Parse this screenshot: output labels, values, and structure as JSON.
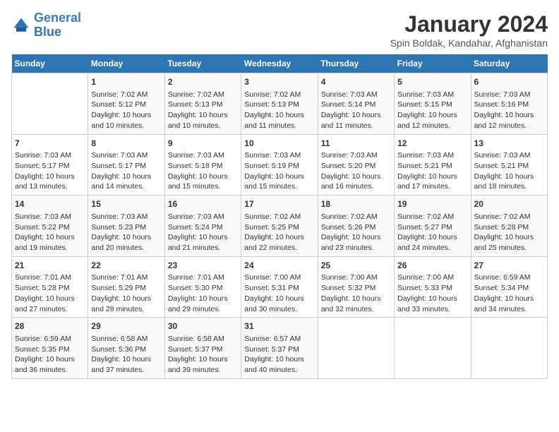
{
  "header": {
    "logo_line1": "General",
    "logo_line2": "Blue",
    "title": "January 2024",
    "subtitle": "Spin Boldak, Kandahar, Afghanistan"
  },
  "columns": [
    "Sunday",
    "Monday",
    "Tuesday",
    "Wednesday",
    "Thursday",
    "Friday",
    "Saturday"
  ],
  "weeks": [
    [
      {
        "num": "",
        "info": ""
      },
      {
        "num": "1",
        "info": "Sunrise: 7:02 AM\nSunset: 5:12 PM\nDaylight: 10 hours\nand 10 minutes."
      },
      {
        "num": "2",
        "info": "Sunrise: 7:02 AM\nSunset: 5:13 PM\nDaylight: 10 hours\nand 10 minutes."
      },
      {
        "num": "3",
        "info": "Sunrise: 7:02 AM\nSunset: 5:13 PM\nDaylight: 10 hours\nand 11 minutes."
      },
      {
        "num": "4",
        "info": "Sunrise: 7:03 AM\nSunset: 5:14 PM\nDaylight: 10 hours\nand 11 minutes."
      },
      {
        "num": "5",
        "info": "Sunrise: 7:03 AM\nSunset: 5:15 PM\nDaylight: 10 hours\nand 12 minutes."
      },
      {
        "num": "6",
        "info": "Sunrise: 7:03 AM\nSunset: 5:16 PM\nDaylight: 10 hours\nand 12 minutes."
      }
    ],
    [
      {
        "num": "7",
        "info": "Sunrise: 7:03 AM\nSunset: 5:17 PM\nDaylight: 10 hours\nand 13 minutes."
      },
      {
        "num": "8",
        "info": "Sunrise: 7:03 AM\nSunset: 5:17 PM\nDaylight: 10 hours\nand 14 minutes."
      },
      {
        "num": "9",
        "info": "Sunrise: 7:03 AM\nSunset: 5:18 PM\nDaylight: 10 hours\nand 15 minutes."
      },
      {
        "num": "10",
        "info": "Sunrise: 7:03 AM\nSunset: 5:19 PM\nDaylight: 10 hours\nand 15 minutes."
      },
      {
        "num": "11",
        "info": "Sunrise: 7:03 AM\nSunset: 5:20 PM\nDaylight: 10 hours\nand 16 minutes."
      },
      {
        "num": "12",
        "info": "Sunrise: 7:03 AM\nSunset: 5:21 PM\nDaylight: 10 hours\nand 17 minutes."
      },
      {
        "num": "13",
        "info": "Sunrise: 7:03 AM\nSunset: 5:21 PM\nDaylight: 10 hours\nand 18 minutes."
      }
    ],
    [
      {
        "num": "14",
        "info": "Sunrise: 7:03 AM\nSunset: 5:22 PM\nDaylight: 10 hours\nand 19 minutes."
      },
      {
        "num": "15",
        "info": "Sunrise: 7:03 AM\nSunset: 5:23 PM\nDaylight: 10 hours\nand 20 minutes."
      },
      {
        "num": "16",
        "info": "Sunrise: 7:03 AM\nSunset: 5:24 PM\nDaylight: 10 hours\nand 21 minutes."
      },
      {
        "num": "17",
        "info": "Sunrise: 7:02 AM\nSunset: 5:25 PM\nDaylight: 10 hours\nand 22 minutes."
      },
      {
        "num": "18",
        "info": "Sunrise: 7:02 AM\nSunset: 5:26 PM\nDaylight: 10 hours\nand 23 minutes."
      },
      {
        "num": "19",
        "info": "Sunrise: 7:02 AM\nSunset: 5:27 PM\nDaylight: 10 hours\nand 24 minutes."
      },
      {
        "num": "20",
        "info": "Sunrise: 7:02 AM\nSunset: 5:28 PM\nDaylight: 10 hours\nand 25 minutes."
      }
    ],
    [
      {
        "num": "21",
        "info": "Sunrise: 7:01 AM\nSunset: 5:28 PM\nDaylight: 10 hours\nand 27 minutes."
      },
      {
        "num": "22",
        "info": "Sunrise: 7:01 AM\nSunset: 5:29 PM\nDaylight: 10 hours\nand 28 minutes."
      },
      {
        "num": "23",
        "info": "Sunrise: 7:01 AM\nSunset: 5:30 PM\nDaylight: 10 hours\nand 29 minutes."
      },
      {
        "num": "24",
        "info": "Sunrise: 7:00 AM\nSunset: 5:31 PM\nDaylight: 10 hours\nand 30 minutes."
      },
      {
        "num": "25",
        "info": "Sunrise: 7:00 AM\nSunset: 5:32 PM\nDaylight: 10 hours\nand 32 minutes."
      },
      {
        "num": "26",
        "info": "Sunrise: 7:00 AM\nSunset: 5:33 PM\nDaylight: 10 hours\nand 33 minutes."
      },
      {
        "num": "27",
        "info": "Sunrise: 6:59 AM\nSunset: 5:34 PM\nDaylight: 10 hours\nand 34 minutes."
      }
    ],
    [
      {
        "num": "28",
        "info": "Sunrise: 6:59 AM\nSunset: 5:35 PM\nDaylight: 10 hours\nand 36 minutes."
      },
      {
        "num": "29",
        "info": "Sunrise: 6:58 AM\nSunset: 5:36 PM\nDaylight: 10 hours\nand 37 minutes."
      },
      {
        "num": "30",
        "info": "Sunrise: 6:58 AM\nSunset: 5:37 PM\nDaylight: 10 hours\nand 39 minutes."
      },
      {
        "num": "31",
        "info": "Sunrise: 6:57 AM\nSunset: 5:37 PM\nDaylight: 10 hours\nand 40 minutes."
      },
      {
        "num": "",
        "info": ""
      },
      {
        "num": "",
        "info": ""
      },
      {
        "num": "",
        "info": ""
      }
    ]
  ]
}
